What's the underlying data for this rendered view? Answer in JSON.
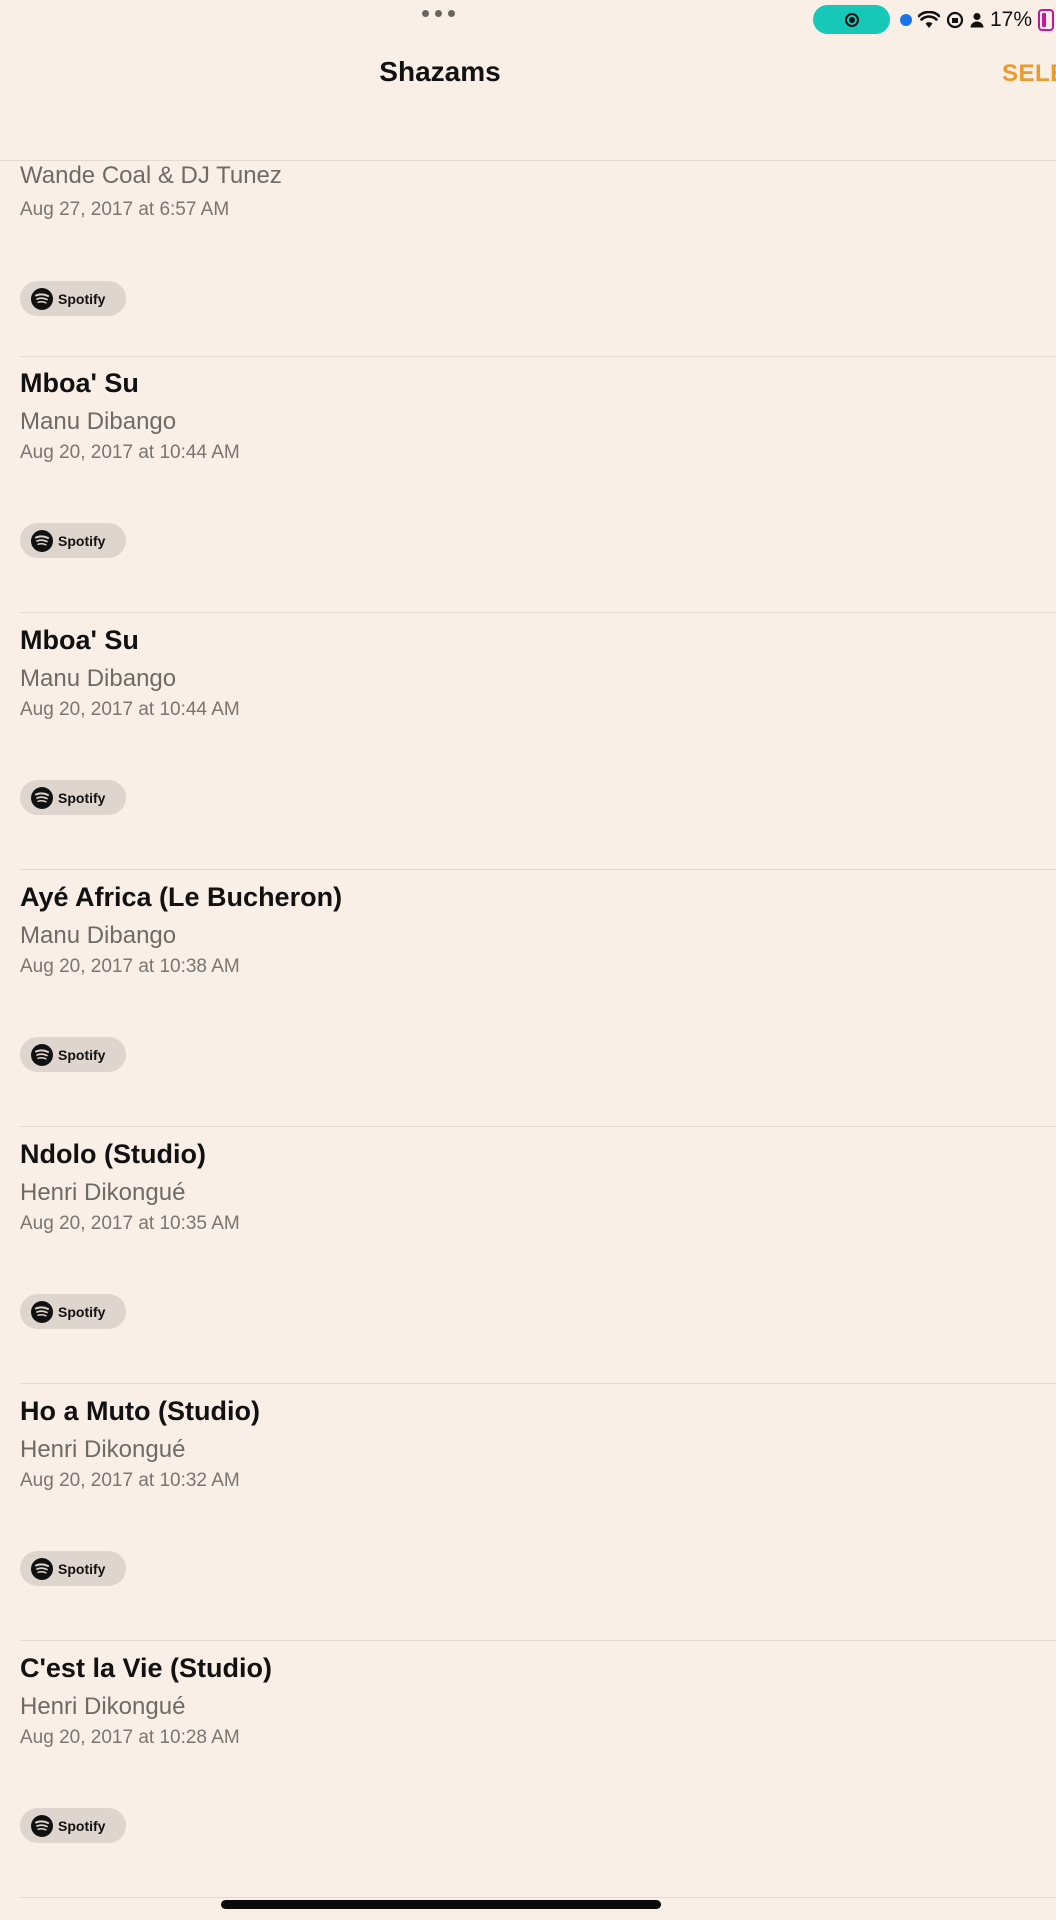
{
  "status_bar": {
    "battery_text": "17%"
  },
  "nav": {
    "title": "Shazams",
    "select_label": "SELE",
    "accent_color": "#ec9a2b"
  },
  "items": [
    {
      "title": "",
      "artist": "Wande Coal & DJ Tunez",
      "date": "Aug 27, 2017 at 6:57 AM",
      "button": "Spotify"
    },
    {
      "title": "Mboa' Su",
      "artist": "Manu Dibango",
      "date": "Aug 20, 2017 at 10:44 AM",
      "button": "Spotify"
    },
    {
      "title": "Mboa' Su",
      "artist": "Manu Dibango",
      "date": "Aug 20, 2017 at 10:44 AM",
      "button": "Spotify"
    },
    {
      "title": "Ayé Africa (Le Bucheron)",
      "artist": "Manu Dibango",
      "date": "Aug 20, 2017 at 10:38 AM",
      "button": "Spotify"
    },
    {
      "title": "Ndolo (Studio)",
      "artist": "Henri Dikongué",
      "date": "Aug 20, 2017 at 10:35 AM",
      "button": "Spotify"
    },
    {
      "title": "Ho a Muto (Studio)",
      "artist": "Henri Dikongué",
      "date": "Aug 20, 2017 at 10:32 AM",
      "button": "Spotify"
    },
    {
      "title": "C'est la Vie (Studio)",
      "artist": "Henri Dikongué",
      "date": "Aug 20, 2017 at 10:28 AM",
      "button": "Spotify"
    }
  ]
}
